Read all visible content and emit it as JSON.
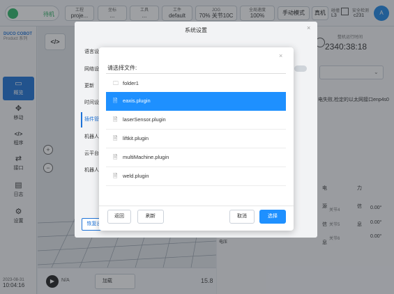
{
  "topbar": {
    "robot_status": "待机",
    "project": {
      "label": "工程",
      "value": "proje..."
    },
    "coord1": {
      "label": "坐标",
      "value": "..."
    },
    "tool": {
      "label": "工具",
      "value": "..."
    },
    "workpiece": {
      "label": "工件",
      "value": "default"
    },
    "jog": {
      "label": "JOG",
      "value": "70% 关节10C"
    },
    "global_speed": {
      "label": "全局速度",
      "value": "100%"
    },
    "manual_mode": "手动模式",
    "real_machine": "真机",
    "safety": {
      "label1": "碰撞",
      "value1": "L3",
      "label2": "安全检测",
      "value2": "c231"
    },
    "avatar": "A"
  },
  "sidebar": {
    "logo_line1": "DUCO COBOT",
    "logo_line2": "Product 系列",
    "items": [
      {
        "label": "概览",
        "icon": "monitor-icon",
        "glyph": "▭"
      },
      {
        "label": "移动",
        "icon": "move-icon",
        "glyph": "✥"
      },
      {
        "label": "程序",
        "icon": "code-icon",
        "glyph": "</>"
      },
      {
        "label": "接口",
        "icon": "interface-icon",
        "glyph": "⇄"
      },
      {
        "label": "日志",
        "icon": "log-icon",
        "glyph": "▤"
      },
      {
        "label": "设置",
        "icon": "settings-icon",
        "glyph": "⚙"
      }
    ],
    "date": "2023-08-31",
    "time": "10:04:16"
  },
  "canvas": {
    "code_button": "</>",
    "zoom_in": "+",
    "zoom_out": "−"
  },
  "progbar": {
    "play": "▶",
    "status": "N/A",
    "speed_label": "加载",
    "speed_value": "15.8"
  },
  "rpanel": {
    "runtime_label": "整机运行时间",
    "runtime_value": "2340:38:18",
    "network_error": "电失败,检定的以太网接口enp4s0",
    "tabs": [
      "电源信息",
      "力信息"
    ],
    "joints": [
      {
        "name": "关节4",
        "value": "0.00°"
      },
      {
        "name": "关节5",
        "value": "0.00°"
      },
      {
        "name": "关节6",
        "value": "0.00°"
      }
    ],
    "voltage_label": "电压"
  },
  "system_settings": {
    "title": "系统设置",
    "close": "×",
    "menu": [
      "语言设",
      "网络设",
      "更新",
      "时间设",
      "插件管",
      "机器人",
      "云平台",
      "机器人"
    ],
    "active_index": 4,
    "restore_button": "恢复出"
  },
  "file_dialog": {
    "close": "×",
    "title": "请选择文件:",
    "files": [
      {
        "name": "folder1",
        "type": "folder",
        "icon": "folder-icon"
      },
      {
        "name": "eaxis.plugin",
        "type": "file",
        "icon": "file-icon",
        "selected": true
      },
      {
        "name": "laserSensor.plugin",
        "type": "file",
        "icon": "file-icon"
      },
      {
        "name": "liftkit.plugin",
        "type": "file",
        "icon": "file-icon"
      },
      {
        "name": "multiMachine.plugin",
        "type": "file",
        "icon": "file-icon"
      },
      {
        "name": "weld.plugin",
        "type": "file",
        "icon": "file-icon"
      }
    ],
    "buttons": {
      "back": "返回",
      "refresh": "刷新",
      "cancel": "取消",
      "select": "选择"
    }
  },
  "colors": {
    "accent": "#1e90ff",
    "brand": "#1e73d8",
    "status_green": "#2fb96b"
  }
}
